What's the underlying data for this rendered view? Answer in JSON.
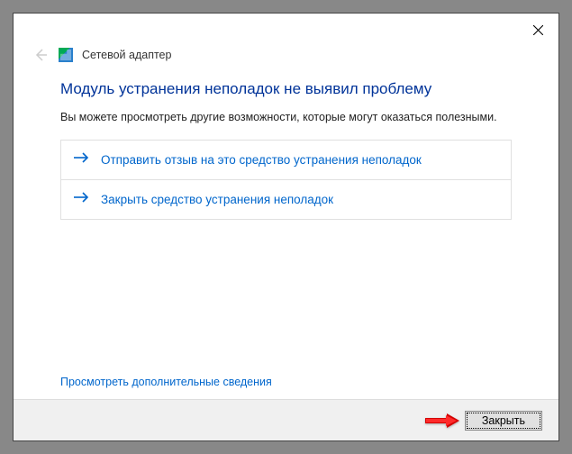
{
  "window": {
    "app_name": "Сетевой адаптер"
  },
  "content": {
    "heading": "Модуль устранения неполадок не выявил проблему",
    "subtext": "Вы можете просмотреть другие возможности, которые могут оказаться полезными.",
    "options": {
      "feedback": "Отправить отзыв на это средство устранения неполадок",
      "close_tool": "Закрыть средство устранения неполадок"
    },
    "more_link": "Просмотреть дополнительные сведения"
  },
  "footer": {
    "close_button": "Закрыть"
  }
}
